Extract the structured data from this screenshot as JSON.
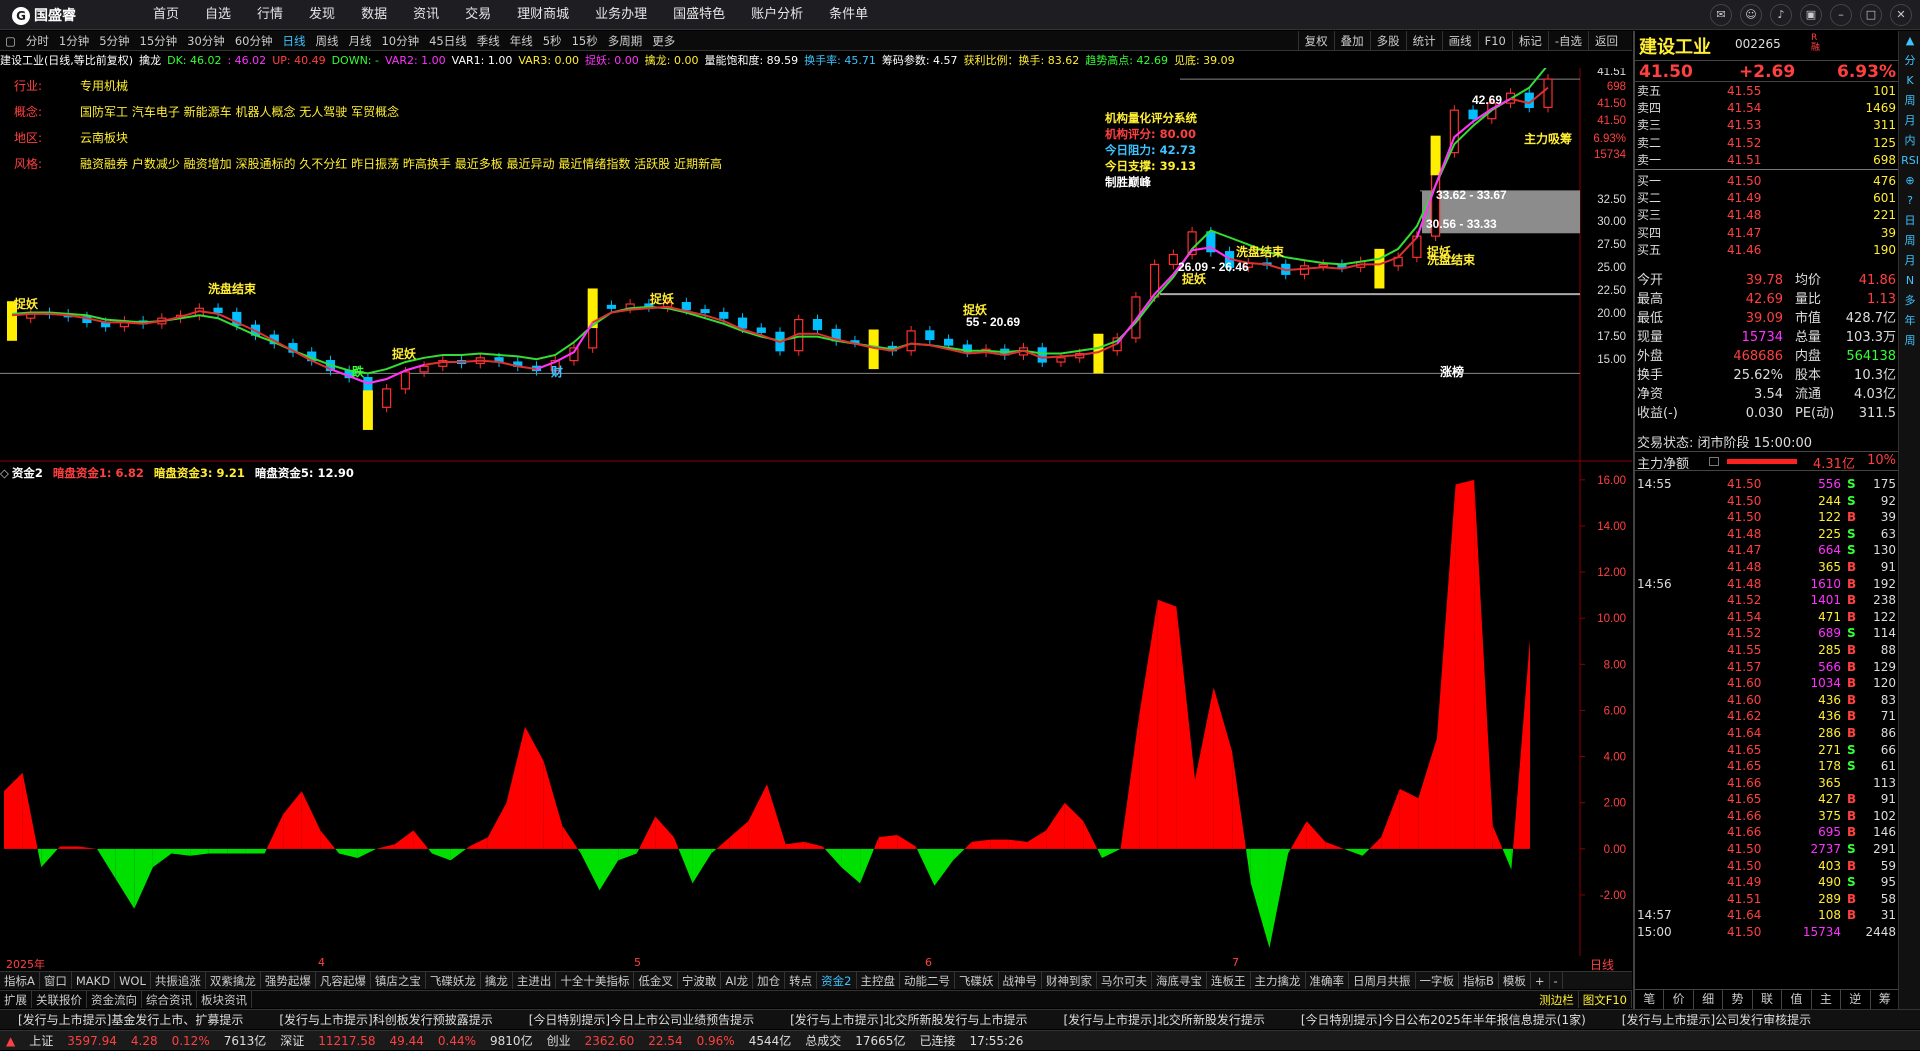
{
  "app": {
    "logo": "国盛睿",
    "menu": [
      "首页",
      "自选",
      "行情",
      "发现",
      "数据",
      "资讯",
      "交易",
      "理财商城",
      "业务办理",
      "国盛特色",
      "账户分析",
      "条件单"
    ]
  },
  "timeframes": [
    "分时",
    "1分钟",
    "5分钟",
    "15分钟",
    "30分钟",
    "60分钟",
    "日线",
    "周线",
    "月线",
    "10分钟",
    "45日线",
    "季线",
    "年线",
    "5秒",
    "15秒",
    "多周期",
    "更多"
  ],
  "tools": [
    "复权",
    "叠加",
    "多股",
    "统计",
    "画线",
    "F10",
    "标记",
    "-自选",
    "返回"
  ],
  "indicator_line": [
    {
      "t": "建设工业(日线,等比前复权)",
      "c": "#ffffff"
    },
    {
      "t": "擒龙",
      "c": "#ffffff"
    },
    {
      "t": "DK: 46.02",
      "c": "#33ff33"
    },
    {
      "t": ": 46.02",
      "c": "#ff33ff"
    },
    {
      "t": "UP: 40.49",
      "c": "#ff4040"
    },
    {
      "t": "DOWN: -",
      "c": "#33ff33"
    },
    {
      "t": "VAR2: 1.00",
      "c": "#ff33ff"
    },
    {
      "t": "VAR1: 1.00",
      "c": "#ffffff"
    },
    {
      "t": "VAR3: 0.00",
      "c": "#ffee33"
    },
    {
      "t": "捉妖: 0.00",
      "c": "#ff33ff"
    },
    {
      "t": "擒龙: 0.00",
      "c": "#ffee33"
    },
    {
      "t": "量能饱和度: 89.59",
      "c": "#ffffff"
    },
    {
      "t": "换手率: 45.71",
      "c": "#3dc3ff"
    },
    {
      "t": "筹码参数: 4.57",
      "c": "#ffffff"
    },
    {
      "t": "获利比例：换手: 83.62",
      "c": "#ffee33"
    },
    {
      "t": "趋势高点: 42.69",
      "c": "#33ff33"
    },
    {
      "t": "见底: 39.09",
      "c": "#ffee33"
    }
  ],
  "info": [
    {
      "k": "行业:",
      "v": "专用机械"
    },
    {
      "k": "概念:",
      "v": "国防军工 汽车电子 新能源车 机器人概念 无人驾驶 军贸概念"
    },
    {
      "k": "地区:",
      "v": "云南板块"
    },
    {
      "k": "风格:",
      "v": "融资融券 户数减少 融资增加 深股通标的 久不分红 昨日振荡 昨高换手 最近多板 最近异动 最近情绪指数 活跃股 近期新高"
    }
  ],
  "score": [
    {
      "t": "机构量化评分系统",
      "c": "#ffee33"
    },
    {
      "t": "机构评分: 80.00",
      "c": "#ff4040"
    },
    {
      "t": "今日阻力: 42.73",
      "c": "#3dc3ff"
    },
    {
      "t": "今日支撑: 39.13",
      "c": "#ffee33"
    },
    {
      "t": "制胜巅峰",
      "c": "#ffffff"
    }
  ],
  "main_axis": [
    "41.51",
    "698",
    "41.50",
    "41.50",
    "6.93%",
    "15734",
    "32.50",
    "30.00",
    "27.50",
    "25.00",
    "22.50",
    "20.00",
    "17.50",
    "15.00"
  ],
  "chart_labels": [
    {
      "t": "捉妖"
    },
    {
      "t": "洗盘结束"
    },
    {
      "t": "捉妖"
    },
    {
      "t": "捉妖"
    },
    {
      "t": "捉妖"
    },
    {
      "t": "捉妖"
    },
    {
      "t": "洗盘结束"
    },
    {
      "t": "捉妖"
    },
    {
      "t": "洗盘结束"
    },
    {
      "t": "主力吸筹"
    },
    {
      "t": "33.62 - 33.67"
    },
    {
      "t": "30.56 - 33.33"
    },
    {
      "t": "26.09 - 26.46"
    },
    {
      "t": "55 - 20.69"
    },
    {
      "t": "42.69"
    },
    {
      "t": "跌"
    },
    {
      "t": "财"
    },
    {
      "t": "涨榜"
    }
  ],
  "sub_header": [
    {
      "t": "资金2",
      "c": "#ffffff"
    },
    {
      "t": "暗盘资金1: 6.82",
      "c": "#ff4040"
    },
    {
      "t": "暗盘资金3: 9.21",
      "c": "#ffee33"
    },
    {
      "t": "暗盘资金5: 12.90",
      "c": "#ffffff"
    }
  ],
  "sub_axis": [
    "16.00",
    "14.00",
    "12.00",
    "10.00",
    "8.00",
    "6.00",
    "4.00",
    "2.00",
    "0.00",
    "-2.00"
  ],
  "dates": [
    "2025年",
    "4",
    "5",
    "6",
    "7"
  ],
  "period_label": "日线",
  "chart_data": [
    {
      "type": "candlestick",
      "title": "建设工业(日线,等比前复权)",
      "ylim": [
        15,
        42
      ],
      "close": [
        24.6,
        25.0,
        24.9,
        24.7,
        24.3,
        24.0,
        24.4,
        24.2,
        24.6,
        24.8,
        25.3,
        25.0,
        24.1,
        23.4,
        22.8,
        22.2,
        21.6,
        20.9,
        20.4,
        18.3,
        19.6,
        20.8,
        21.2,
        21.6,
        21.4,
        21.8,
        21.5,
        21.2,
        20.9,
        21.6,
        22.5,
        25.5,
        25.3,
        25.6,
        25.4,
        25.7,
        25.2,
        25.0,
        24.6,
        23.9,
        23.6,
        22.3,
        24.5,
        23.8,
        23.0,
        22.9,
        22.6,
        22.3,
        23.7,
        23.1,
        22.7,
        22.2,
        22.4,
        22.0,
        22.5,
        21.5,
        21.8,
        22.1,
        22.3,
        23.2,
        26.1,
        28.4,
        29.1,
        30.7,
        29.3,
        28.2,
        28.5,
        28.4,
        27.7,
        28.3,
        28.4,
        28.2,
        28.6,
        28.3,
        28.9,
        30.4,
        36.3,
        39.3,
        38.7,
        39.8,
        40.5,
        39.5,
        41.5
      ],
      "ma_green": [
        24.9,
        25.0,
        25.0,
        24.9,
        24.8,
        24.5,
        24.4,
        24.3,
        24.4,
        24.6,
        24.8,
        24.6,
        24.0,
        23.4,
        22.9,
        22.3,
        21.8,
        21.3,
        20.9,
        20.7,
        21.0,
        21.5,
        21.8,
        22.0,
        22.0,
        22.1,
        22.0,
        21.9,
        21.7,
        22.0,
        22.9,
        24.1,
        25.0,
        25.3,
        25.4,
        25.3,
        25.0,
        24.6,
        24.2,
        23.7,
        23.3,
        23.0,
        23.3,
        23.3,
        23.0,
        22.8,
        22.6,
        22.4,
        22.8,
        22.7,
        22.5,
        22.3,
        22.3,
        22.2,
        22.3,
        22.1,
        22.1,
        22.3,
        22.5,
        23.0,
        24.3,
        26.0,
        27.5,
        29.5,
        30.8,
        30.3,
        29.8,
        29.3,
        28.9,
        28.7,
        28.5,
        28.4,
        28.6,
        28.8,
        29.5,
        31.1,
        34.0,
        36.9,
        38.2,
        39.3,
        40.1,
        40.9,
        42.5
      ],
      "ma_red": [
        24.8,
        24.9,
        24.9,
        24.8,
        24.6,
        24.3,
        24.3,
        24.2,
        24.4,
        24.7,
        25.1,
        24.9,
        24.3,
        23.7,
        23.0,
        22.3,
        21.6,
        21.0,
        20.5,
        20.0,
        20.3,
        20.9,
        21.3,
        21.5,
        21.5,
        21.6,
        21.5,
        21.2,
        21.0,
        21.5,
        22.2,
        24.3,
        25.0,
        25.2,
        25.3,
        25.4,
        25.1,
        24.8,
        24.4,
        23.8,
        23.4,
        22.9,
        23.5,
        23.5,
        23.1,
        22.8,
        22.5,
        22.3,
        22.8,
        22.7,
        22.4,
        22.1,
        22.2,
        22.0,
        22.3,
        21.8,
        21.9,
        22.0,
        22.2,
        22.8,
        24.5,
        26.3,
        27.7,
        29.4,
        29.6,
        28.8,
        28.5,
        28.4,
        28.0,
        28.1,
        28.2,
        28.1,
        28.4,
        28.4,
        28.9,
        30.3,
        34.0,
        37.4,
        38.5,
        39.4,
        40.1,
        39.8,
        40.9
      ]
    },
    {
      "type": "area",
      "title": "资金2",
      "values": [
        2.5,
        3.3,
        -0.8,
        0.1,
        0.1,
        0.0,
        -1.3,
        -2.6,
        -0.8,
        -0.2,
        -0.3,
        -0.2,
        -0.2,
        -0.2,
        -0.2,
        1.5,
        2.5,
        0.8,
        -0.2,
        -0.4,
        0.0,
        0.2,
        0.8,
        -0.2,
        -0.5,
        0.1,
        0.5,
        2.0,
        5.3,
        3.8,
        1.0,
        -0.2,
        -1.8,
        -0.5,
        -0.2,
        1.4,
        0.5,
        -1.5,
        -0.2,
        0.5,
        1.2,
        2.8,
        0.2,
        0.3,
        0.1,
        -0.8,
        -1.5,
        0.5,
        0.6,
        0.1,
        -1.6,
        -0.5,
        0.3,
        0.4,
        0.4,
        0.3,
        0.8,
        2.0,
        1.2,
        -0.4,
        0.0,
        5.8,
        10.8,
        10.5,
        3.0,
        7.0,
        4.2,
        -1.5,
        -4.3,
        -0.2,
        1.2,
        0.3,
        0.0,
        -0.3,
        0.5,
        2.6,
        2.2,
        4.8,
        15.8,
        16.0,
        1.0,
        -0.9,
        9.1
      ]
    }
  ],
  "right": {
    "name": "建设工业",
    "code": "002265",
    "tag": "R",
    "tag2": "融",
    "price": "41.50",
    "change": "+2.69",
    "pct": "6.93%",
    "asks": [
      {
        "l": "卖五",
        "p": "41.55",
        "v": "101"
      },
      {
        "l": "卖四",
        "p": "41.54",
        "v": "1469"
      },
      {
        "l": "卖三",
        "p": "41.53",
        "v": "311"
      },
      {
        "l": "卖二",
        "p": "41.52",
        "v": "125"
      },
      {
        "l": "卖一",
        "p": "41.51",
        "v": "698"
      }
    ],
    "bids": [
      {
        "l": "买一",
        "p": "41.50",
        "v": "476"
      },
      {
        "l": "买二",
        "p": "41.49",
        "v": "601"
      },
      {
        "l": "买三",
        "p": "41.48",
        "v": "221"
      },
      {
        "l": "买四",
        "p": "41.47",
        "v": "39"
      },
      {
        "l": "买五",
        "p": "41.46",
        "v": "190"
      }
    ],
    "stats": [
      {
        "a": "今开",
        "b": "39.78",
        "bc": "#ff4040",
        "c": "均价",
        "d": "41.86",
        "dc": "#ff4040"
      },
      {
        "a": "最高",
        "b": "42.69",
        "bc": "#ff4040",
        "c": "量比",
        "d": "1.13",
        "dc": "#ff4040"
      },
      {
        "a": "最低",
        "b": "39.09",
        "bc": "#ff4040",
        "c": "市值",
        "d": "428.7亿",
        "dc": "#dddddd"
      },
      {
        "a": "现量",
        "b": "15734",
        "bc": "#ff33ff",
        "c": "总量",
        "d": "103.3万",
        "dc": "#dddddd"
      },
      {
        "a": "外盘",
        "b": "468686",
        "bc": "#ff4040",
        "c": "内盘",
        "d": "564138",
        "dc": "#33ff33"
      },
      {
        "a": "换手",
        "b": "25.62%",
        "bc": "#dddddd",
        "c": "股本",
        "d": "10.3亿",
        "dc": "#dddddd"
      },
      {
        "a": "净资",
        "b": "3.54",
        "bc": "#dddddd",
        "c": "流通",
        "d": "4.03亿",
        "dc": "#dddddd"
      },
      {
        "a": "收益(-)",
        "b": "0.030",
        "bc": "#dddddd",
        "c": "PE(动)",
        "d": "311.5",
        "dc": "#dddddd"
      }
    ],
    "trade_state": "交易状态: 闭市阶段 15:00:00",
    "net_label": "主力净额",
    "net_value": "4.31亿",
    "net_pct": "10%",
    "trades": [
      {
        "t": "14:55",
        "p": "41.50",
        "v": "556",
        "vc": "#ff33ff",
        "s": "S",
        "n": "175"
      },
      {
        "t": "",
        "p": "41.50",
        "v": "244",
        "vc": "#ffee33",
        "s": "S",
        "n": "92"
      },
      {
        "t": "",
        "p": "41.50",
        "v": "122",
        "vc": "#ffee33",
        "s": "B",
        "n": "39"
      },
      {
        "t": "",
        "p": "41.48",
        "v": "225",
        "vc": "#ffee33",
        "s": "S",
        "n": "63"
      },
      {
        "t": "",
        "p": "41.47",
        "v": "664",
        "vc": "#ff33ff",
        "s": "S",
        "n": "130"
      },
      {
        "t": "",
        "p": "41.48",
        "v": "365",
        "vc": "#ffee33",
        "s": "B",
        "n": "91"
      },
      {
        "t": "14:56",
        "p": "41.48",
        "v": "1610",
        "vc": "#ff33ff",
        "s": "B",
        "n": "192"
      },
      {
        "t": "",
        "p": "41.52",
        "v": "1401",
        "vc": "#ff33ff",
        "s": "B",
        "n": "238"
      },
      {
        "t": "",
        "p": "41.54",
        "v": "471",
        "vc": "#ffee33",
        "s": "B",
        "n": "122"
      },
      {
        "t": "",
        "p": "41.52",
        "v": "689",
        "vc": "#ff33ff",
        "s": "S",
        "n": "114"
      },
      {
        "t": "",
        "p": "41.55",
        "v": "285",
        "vc": "#ffee33",
        "s": "B",
        "n": "88"
      },
      {
        "t": "",
        "p": "41.57",
        "v": "566",
        "vc": "#ff33ff",
        "s": "B",
        "n": "129"
      },
      {
        "t": "",
        "p": "41.60",
        "v": "1034",
        "vc": "#ff33ff",
        "s": "B",
        "n": "120"
      },
      {
        "t": "",
        "p": "41.60",
        "v": "436",
        "vc": "#ffee33",
        "s": "B",
        "n": "83"
      },
      {
        "t": "",
        "p": "41.62",
        "v": "436",
        "vc": "#ffee33",
        "s": "B",
        "n": "71"
      },
      {
        "t": "",
        "p": "41.64",
        "v": "286",
        "vc": "#ffee33",
        "s": "B",
        "n": "86"
      },
      {
        "t": "",
        "p": "41.65",
        "v": "271",
        "vc": "#ffee33",
        "s": "S",
        "n": "66"
      },
      {
        "t": "",
        "p": "41.65",
        "v": "178",
        "vc": "#ffee33",
        "s": "S",
        "n": "61"
      },
      {
        "t": "",
        "p": "41.66",
        "v": "365",
        "vc": "#ffee33",
        "s": "",
        "n": "113"
      },
      {
        "t": "",
        "p": "41.65",
        "v": "427",
        "vc": "#ffee33",
        "s": "B",
        "n": "91"
      },
      {
        "t": "",
        "p": "41.66",
        "v": "375",
        "vc": "#ffee33",
        "s": "B",
        "n": "102"
      },
      {
        "t": "",
        "p": "41.66",
        "v": "695",
        "vc": "#ff33ff",
        "s": "B",
        "n": "146"
      },
      {
        "t": "",
        "p": "41.50",
        "v": "2737",
        "vc": "#ff33ff",
        "s": "S",
        "n": "291"
      },
      {
        "t": "",
        "p": "41.50",
        "v": "403",
        "vc": "#ffee33",
        "s": "B",
        "n": "59"
      },
      {
        "t": "",
        "p": "41.49",
        "v": "490",
        "vc": "#ffee33",
        "s": "S",
        "n": "95"
      },
      {
        "t": "",
        "p": "41.51",
        "v": "289",
        "vc": "#ffee33",
        "s": "B",
        "n": "58"
      },
      {
        "t": "14:57",
        "p": "41.64",
        "v": "108",
        "vc": "#ffee33",
        "s": "B",
        "n": "31"
      },
      {
        "t": "15:00",
        "p": "41.50",
        "v": "15734",
        "vc": "#ff33ff",
        "s": "",
        "n": "2448"
      }
    ],
    "tabs": [
      "笔",
      "价",
      "细",
      "势",
      "联",
      "值",
      "主",
      "逆",
      "筹"
    ]
  },
  "sidebar": [
    "分",
    "K",
    "周",
    "月",
    "内",
    "RSI",
    "⊕",
    "?",
    "日",
    "周",
    "月",
    "N",
    "多",
    "年",
    "周"
  ],
  "tabs1": [
    "指标A",
    "窗口",
    "MAKD",
    "WOL",
    "共振追涨",
    "双紫擒龙",
    "强势起爆",
    "凡容起爆",
    "镇店之宝",
    "飞碟妖龙",
    "擒龙",
    "主进出",
    "十全十美指标",
    "低金叉",
    "宁波敢",
    "AI龙",
    "加仓",
    "转点",
    "资金2",
    "主控盘",
    "动能二号",
    "飞碟妖",
    "战神号",
    "财神到家",
    "马尔可夫",
    "海底寻宝",
    "连板王",
    "主力擒龙",
    "准确率",
    "日周月共振",
    "一字板",
    "指标B",
    "模板",
    "+",
    "-"
  ],
  "tabs2": [
    "扩展",
    "关联报价",
    "资金流向",
    "综合资讯",
    "板块资讯",
    "图文F10",
    "测边栏"
  ],
  "news": [
    "[发行与上市提示]基金发行上市、扩募提示",
    "[发行与上市提示]科创板发行预披露提示",
    "[今日特别提示]今日上市公司业绩预告提示",
    "[发行与上市提示]北交所新股发行与上市提示",
    "[发行与上市提示]北交所新股发行提示",
    "[今日特别提示]今日公布2025年半年报信息提示(1家)",
    "[发行与上市提示]公司发行审核提示"
  ],
  "status": [
    {
      "t": "上证",
      "c": "#dddddd"
    },
    {
      "t": "3597.94",
      "c": "#ff4040"
    },
    {
      "t": "4.28",
      "c": "#ff4040"
    },
    {
      "t": "0.12%",
      "c": "#ff4040"
    },
    {
      "t": "7613亿",
      "c": "#dddddd"
    },
    {
      "t": "深证",
      "c": "#dddddd"
    },
    {
      "t": "11217.58",
      "c": "#ff4040"
    },
    {
      "t": "49.44",
      "c": "#ff4040"
    },
    {
      "t": "0.44%",
      "c": "#ff4040"
    },
    {
      "t": "9810亿",
      "c": "#dddddd"
    },
    {
      "t": "创业",
      "c": "#dddddd"
    },
    {
      "t": "2362.60",
      "c": "#ff4040"
    },
    {
      "t": "22.54",
      "c": "#ff4040"
    },
    {
      "t": "0.96%",
      "c": "#ff4040"
    },
    {
      "t": "4544亿",
      "c": "#dddddd"
    },
    {
      "t": "总成交",
      "c": "#dddddd"
    },
    {
      "t": "17665亿",
      "c": "#dddddd"
    },
    {
      "t": "已连接",
      "c": "#dddddd"
    },
    {
      "t": "17:55:26",
      "c": "#dddddd"
    }
  ]
}
